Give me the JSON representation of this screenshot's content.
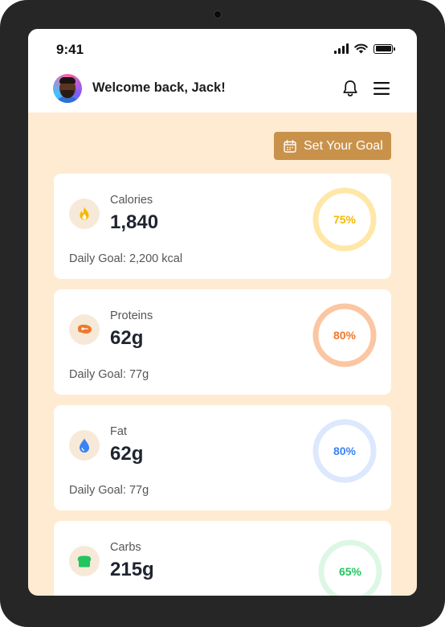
{
  "status_bar": {
    "time": "9:41"
  },
  "header": {
    "welcome": "Welcome back, Jack!",
    "icons": [
      "bell-icon",
      "menu-icon"
    ]
  },
  "actions": {
    "set_goal_label": "Set Your Goal"
  },
  "colors": {
    "background": "#FEEBD1",
    "accent": "#C9924B",
    "calories": "#F5B800",
    "proteins": "#F0782C",
    "fat": "#3B82F6",
    "carbs": "#22C55E"
  },
  "cards": [
    {
      "label": "Calories",
      "value": "1,840",
      "goal": "Daily Goal: 2,200 kcal",
      "percent_label": "75%",
      "icon": "flame-icon"
    },
    {
      "label": "Proteins",
      "value": "62g",
      "goal": "Daily Goal: 77g",
      "percent_label": "80%",
      "icon": "steak-icon"
    },
    {
      "label": "Fat",
      "value": "62g",
      "goal": "Daily Goal: 77g",
      "percent_label": "80%",
      "icon": "droplet-icon"
    },
    {
      "label": "Carbs",
      "value": "215g",
      "goal": "",
      "percent_label": "65%",
      "icon": "bread-icon"
    }
  ]
}
